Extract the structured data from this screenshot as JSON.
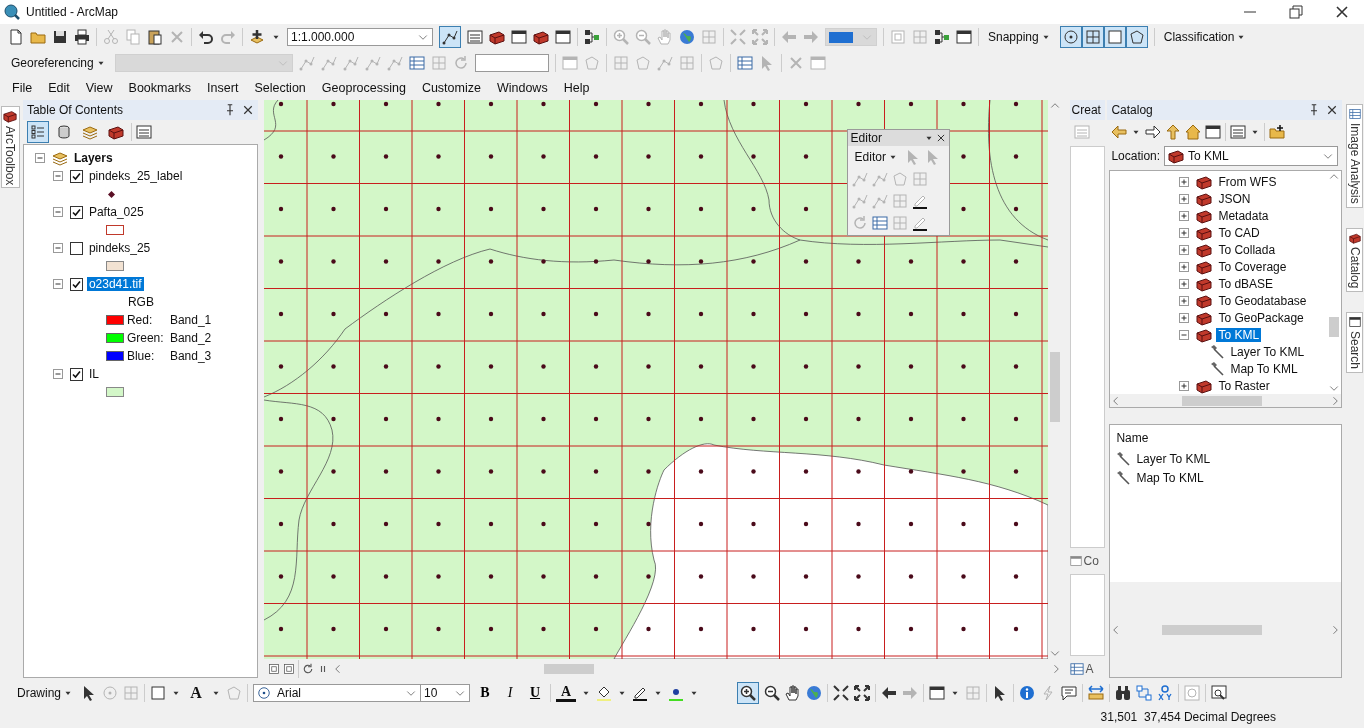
{
  "window": {
    "title": "Untitled - ArcMap"
  },
  "standard_toolbar": {
    "scale": "1:1.000.000",
    "editor_toolbar_toggle": {
      "on": true
    }
  },
  "snapping": {
    "label": "Snapping",
    "tools": [
      {
        "kind": "point",
        "selected": true
      },
      {
        "kind": "vertex",
        "selected": true
      },
      {
        "kind": "edge",
        "selected": true
      },
      {
        "kind": "end",
        "selected": true
      }
    ]
  },
  "classification": {
    "label": "Classification"
  },
  "georeferencing": {
    "label": "Georeferencing"
  },
  "menu": [
    "File",
    "Edit",
    "View",
    "Bookmarks",
    "Insert",
    "Selection",
    "Geoprocessing",
    "Customize",
    "Windows",
    "Help"
  ],
  "left_dock_tabs": [
    "ArcToolbox"
  ],
  "toc": {
    "title": "Table Of Contents",
    "view_buttons": [
      {
        "kind": "drawing-order",
        "selected": true
      },
      {
        "kind": "source",
        "selected": false
      },
      {
        "kind": "visibility",
        "selected": false
      },
      {
        "kind": "selection",
        "selected": false
      }
    ],
    "root": "Layers",
    "layers": [
      {
        "name": "pindeks_25_label",
        "checked": true,
        "selected": false,
        "legend": [
          {
            "kind": "marker",
            "color": "#5a0f25"
          }
        ]
      },
      {
        "name": "Pafta_025",
        "checked": true,
        "selected": false,
        "legend": [
          {
            "kind": "outline",
            "color": "#c0392b"
          }
        ]
      },
      {
        "name": "pindeks_25",
        "checked": false,
        "selected": false,
        "legend": [
          {
            "kind": "fill",
            "color": "#f2e2d2"
          }
        ]
      },
      {
        "name": "o23d41.tif",
        "checked": true,
        "selected": true,
        "legend": [
          {
            "kind": "heading",
            "label": "RGB"
          },
          {
            "kind": "band",
            "color": "#ff0000",
            "channel": "Red:",
            "band": "Band_1"
          },
          {
            "kind": "band",
            "color": "#00ff00",
            "channel": "Green:",
            "band": "Band_2"
          },
          {
            "kind": "band",
            "color": "#0000ff",
            "channel": "Blue:",
            "band": "Band_3"
          }
        ]
      },
      {
        "name": "IL",
        "checked": true,
        "selected": false,
        "legend": [
          {
            "kind": "fill",
            "color": "#d3f7c8"
          }
        ]
      }
    ]
  },
  "editor_window": {
    "title": "Editor",
    "menu": "Editor"
  },
  "create_panel": {
    "title": "Creat",
    "bottom_tabs": [
      "Co",
      "A"
    ]
  },
  "catalog": {
    "title": "Catalog",
    "location_label": "Location:",
    "location": "To KML",
    "tree": [
      {
        "label": "From WFS",
        "expanded": false,
        "selected": false
      },
      {
        "label": "JSON",
        "expanded": false,
        "selected": false
      },
      {
        "label": "Metadata",
        "expanded": false,
        "selected": false
      },
      {
        "label": "To CAD",
        "expanded": false,
        "selected": false
      },
      {
        "label": "To Collada",
        "expanded": false,
        "selected": false
      },
      {
        "label": "To Coverage",
        "expanded": false,
        "selected": false
      },
      {
        "label": "To dBASE",
        "expanded": false,
        "selected": false
      },
      {
        "label": "To Geodatabase",
        "expanded": false,
        "selected": false
      },
      {
        "label": "To GeoPackage",
        "expanded": false,
        "selected": false
      },
      {
        "label": "To KML",
        "expanded": true,
        "selected": true,
        "children": [
          {
            "label": "Layer To KML"
          },
          {
            "label": "Map To KML"
          }
        ]
      },
      {
        "label": "To Raster",
        "expanded": false,
        "selected": false
      }
    ],
    "contents": {
      "column": "Name",
      "items": [
        "Layer To KML",
        "Map To KML"
      ]
    }
  },
  "right_dock_tabs": [
    "Image Analysis",
    "Catalog",
    "Search"
  ],
  "drawing_toolbar": {
    "label": "Drawing",
    "text_tool": "A",
    "font": "Arial",
    "font_size": "10",
    "styles": [
      "B",
      "I",
      "U"
    ],
    "font_color": "A"
  },
  "tools_toolbar": {
    "zoom_in": {
      "selected": true
    }
  },
  "status_bar": {
    "coordinates": "31,501  37,454 Decimal Degrees"
  }
}
